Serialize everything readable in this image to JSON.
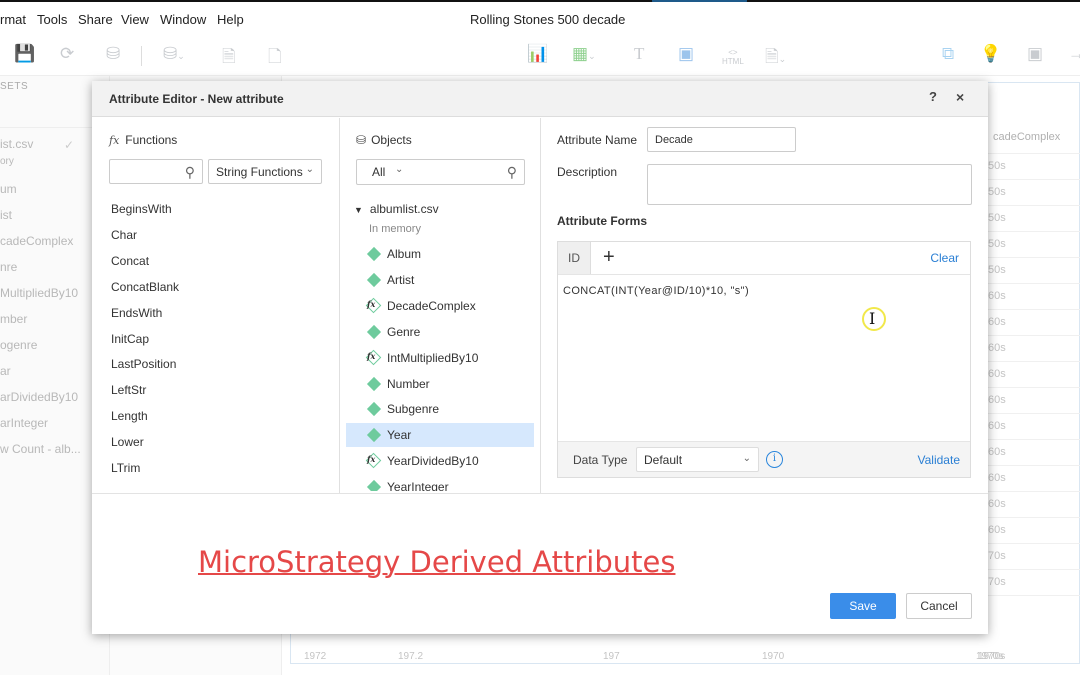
{
  "window": {
    "title": "Rolling Stones 500 decade",
    "menu": [
      "rmat",
      "Tools",
      "Share",
      "View",
      "Window",
      "Help"
    ]
  },
  "toolbar": {
    "left_icons": [
      "save-icon",
      "refresh-icon",
      "data-source-icon",
      "add-data-icon",
      "duplicate-page-icon",
      "new-page-icon"
    ],
    "right_icons": [
      "add-visualization-icon",
      "filter-icon",
      "text-icon",
      "image-icon",
      "html-icon",
      "add-panel-icon",
      "layer-icon",
      "insight-icon",
      "container-icon"
    ],
    "html_label": "HTML"
  },
  "background": {
    "datasets_header": "SETS",
    "dataset_name": "ist.csv",
    "dataset_sub": "ory",
    "items": [
      "um",
      "ist",
      "cadeComplex",
      "nre",
      "MultipliedBy10",
      "mber",
      "ogenre",
      "ar",
      "arDividedBy10",
      "arInteger",
      "w Count - alb..."
    ],
    "column_header": "cadeComplex",
    "column_values": [
      "50s",
      "50s",
      "50s",
      "50s",
      "50s",
      "60s",
      "60s",
      "60s",
      "60s",
      "60s",
      "60s",
      "60s",
      "60s",
      "60s",
      "60s",
      "70s",
      "70s",
      "1970s"
    ],
    "axis_labels": [
      "1972",
      "197.2",
      "197",
      "1970",
      "1970s"
    ]
  },
  "dialog": {
    "title": "Attribute Editor - New attribute",
    "help_label": "?",
    "close_label": "×",
    "functions": {
      "title": "Functions",
      "search_value": "",
      "search_placeholder": "",
      "category": "String Functions",
      "items": [
        "BeginsWith",
        "Char",
        "Concat",
        "ConcatBlank",
        "EndsWith",
        "InitCap",
        "LastPosition",
        "LeftStr",
        "Length",
        "Lower",
        "LTrim"
      ]
    },
    "objects": {
      "title": "Objects",
      "filter": "All",
      "dataset": "albumlist.csv",
      "dataset_status": "In memory",
      "items": [
        {
          "label": "Album",
          "type": "attribute",
          "selected": false
        },
        {
          "label": "Artist",
          "type": "attribute",
          "selected": false
        },
        {
          "label": "DecadeComplex",
          "type": "derived",
          "selected": false
        },
        {
          "label": "Genre",
          "type": "attribute",
          "selected": false
        },
        {
          "label": "IntMultipliedBy10",
          "type": "derived",
          "selected": false
        },
        {
          "label": "Number",
          "type": "attribute",
          "selected": false
        },
        {
          "label": "Subgenre",
          "type": "attribute",
          "selected": false
        },
        {
          "label": "Year",
          "type": "attribute",
          "selected": true
        },
        {
          "label": "YearDividedBy10",
          "type": "derived",
          "selected": false
        },
        {
          "label": "YearInteger",
          "type": "attribute",
          "selected": false
        }
      ]
    },
    "attribute": {
      "name_label": "Attribute Name",
      "name_value": "Decade",
      "description_label": "Description",
      "description_value": "",
      "forms_title": "Attribute Forms",
      "form_tab": "ID",
      "add_form_label": "+",
      "clear_label": "Clear",
      "formula": "CONCAT(INT(Year@ID/10)*10, \"s\")",
      "data_type_label": "Data Type",
      "data_type_value": "Default",
      "validate_label": "Validate"
    },
    "save_label": "Save",
    "cancel_label": "Cancel"
  },
  "overlay_caption": "MicroStrategy Derived Attributes",
  "colors": {
    "accent": "#3a8de9",
    "link": "#2a7fd4",
    "attribute_icon": "#6ecb9d",
    "selected_row": "#d6e8fd",
    "caption": "#e54848"
  }
}
